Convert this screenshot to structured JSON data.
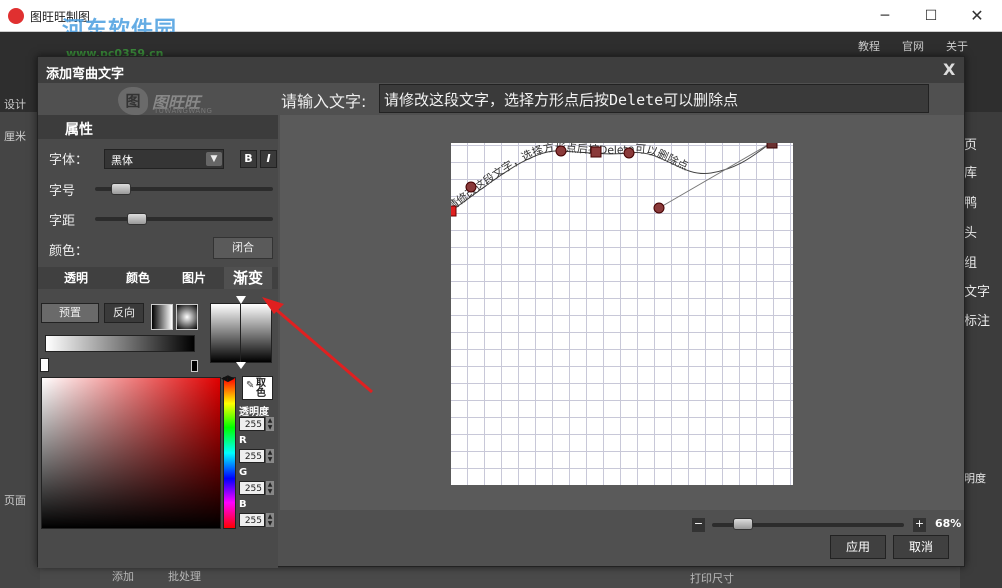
{
  "window": {
    "title": "图旺旺制图",
    "watermark": "河东软件园",
    "watermark_url": "www.pc0359.cn",
    "min_glyph": "─",
    "max_glyph": "☐",
    "close_glyph": "✕"
  },
  "background_app": {
    "top_links": [
      "教程",
      "官网",
      "关于"
    ],
    "left_labels": [
      "设计",
      "厘米",
      "页面"
    ],
    "right_items": [
      "页",
      "库",
      "鸭",
      "头",
      "组",
      "文字",
      "标注",
      "明度"
    ],
    "bottom_items": [
      "添加",
      "批处理",
      "打印尺寸"
    ]
  },
  "dialog": {
    "title": "添加弯曲文字",
    "close_label": "X",
    "logo_text": "图旺旺",
    "logo_sub": "TUWANGWANG",
    "logo_mark": "图",
    "input_label": "请输入文字:",
    "input_value": "请修改这段文字，选择方形点后按Delete可以删除点",
    "properties": {
      "header": "属性",
      "font_label": "字体：",
      "font_value": "黑体",
      "bold_label": "B",
      "italic_label": "I",
      "size_label": "字号",
      "spacing_label": "字距",
      "color_label": "颜色：",
      "close_button": "闭合",
      "size_level": 0.1,
      "spacing_level": 0.2
    },
    "tabs": [
      {
        "label": "透明",
        "active": false
      },
      {
        "label": "颜色",
        "active": false
      },
      {
        "label": "图片",
        "active": false
      },
      {
        "label": "渐变",
        "active": true
      }
    ],
    "gradient": {
      "preset_button": "预置",
      "reverse_button": "反向",
      "linear_icon": "linear-gradient-icon",
      "radial_icon": "radial-gradient-icon"
    },
    "color_picker": {
      "eyedrop_label": "取色",
      "opacity_label": "透明度",
      "opacity_value": "255",
      "r_label": "R",
      "r_value": "255",
      "g_label": "G",
      "g_value": "255",
      "b_label": "B",
      "b_value": "255"
    },
    "canvas_text": "请修改这段文字，选择方形点后按Delete可以删除点",
    "zoom": {
      "minus": "−",
      "plus": "+",
      "value": "68%",
      "level": 0.12
    },
    "apply_button": "应用",
    "cancel_button": "取消"
  },
  "colors": {
    "accent_red": "#e02020",
    "point_fill": "#8a3a3a"
  }
}
